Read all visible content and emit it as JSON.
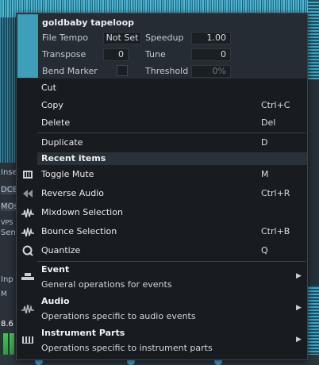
{
  "background": {
    "left_labels": [
      "Inse",
      "DC8",
      "MOs",
      "VPS",
      "Sen",
      "Inp",
      "M",
      "8.6"
    ]
  },
  "header": {
    "clip_name": "goldbaby tapeloop",
    "file_tempo_label": "File Tempo",
    "file_tempo_value": "Not Set",
    "speedup_label": "Speedup",
    "speedup_value": "1.00",
    "transpose_label": "Transpose",
    "transpose_value": "0",
    "tune_label": "Tune",
    "tune_value": "0",
    "bend_marker_label": "Bend Marker",
    "threshold_label": "Threshold",
    "threshold_value": "0%"
  },
  "menu": {
    "cut": "Cut",
    "copy": "Copy",
    "copy_shortcut": "Ctrl+C",
    "delete": "Delete",
    "delete_shortcut": "Del",
    "duplicate": "Duplicate",
    "duplicate_shortcut": "D",
    "recent_items": "Recent items",
    "toggle_mute": "Toggle Mute",
    "toggle_mute_shortcut": "M",
    "reverse_audio": "Reverse Audio",
    "reverse_audio_shortcut": "Ctrl+R",
    "mixdown_selection": "Mixdown Selection",
    "bounce_selection": "Bounce Selection",
    "bounce_selection_shortcut": "Ctrl+B",
    "quantize": "Quantize",
    "quantize_shortcut": "Q",
    "event_title": "Event",
    "event_desc": "General operations for events",
    "audio_title": "Audio",
    "audio_desc": "Operations specific to audio events",
    "instrument_title": "Instrument Parts",
    "instrument_desc": "Operations specific to instrument parts"
  },
  "colors": {
    "clip_accent": "#3f9fb8",
    "menu_bg": "#181c21"
  }
}
